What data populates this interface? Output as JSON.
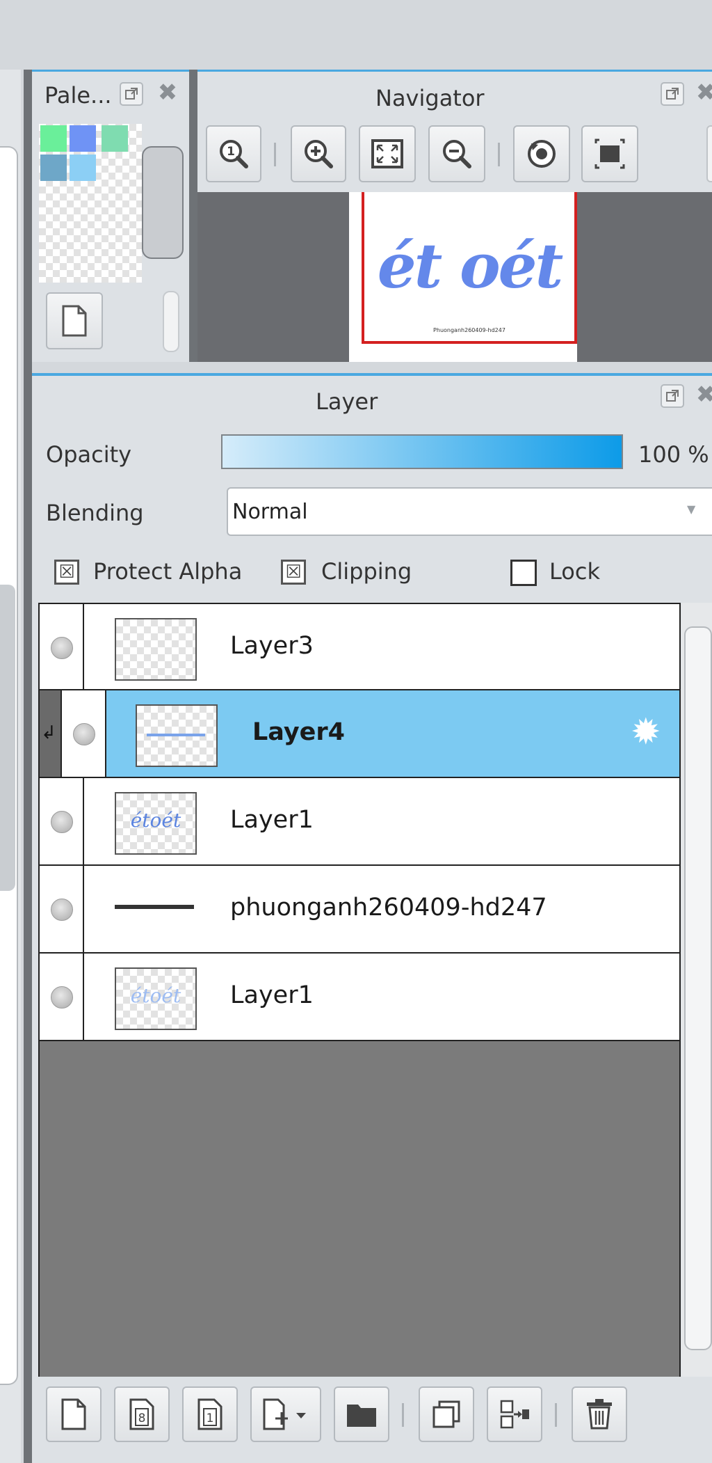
{
  "palette": {
    "title": "Pale...",
    "colors": [
      "#6aef9a",
      "#6f93f5",
      "#7fdcb0",
      "#6ea7c8",
      "#8ccff5"
    ]
  },
  "navigator": {
    "title": "Navigator",
    "preview_text": "ét oét",
    "preview_subtext": "Phuonganh260409-hd247"
  },
  "layer_panel": {
    "title": "Layer",
    "opacity_label": "Opacity",
    "opacity_value": "100 %",
    "opacity_fraction": 1.0,
    "blending_label": "Blending",
    "blending_value": "Normal",
    "protect_alpha_label": "Protect Alpha",
    "clipping_label": "Clipping",
    "lock_label": "Lock",
    "layers": [
      {
        "name": "Layer3"
      },
      {
        "name": "Layer4"
      },
      {
        "name": "Layer1",
        "thumb_text": "étoét"
      },
      {
        "name": "phuonganh260409-hd247"
      },
      {
        "name": "Layer1",
        "thumb_text": "étoét"
      }
    ]
  },
  "colors": {
    "accent": "#7ccaf2",
    "opacity_bar_start": "#d5ecfa",
    "opacity_bar_end": "#0d9be8",
    "navigator_frame": "#d42020"
  }
}
